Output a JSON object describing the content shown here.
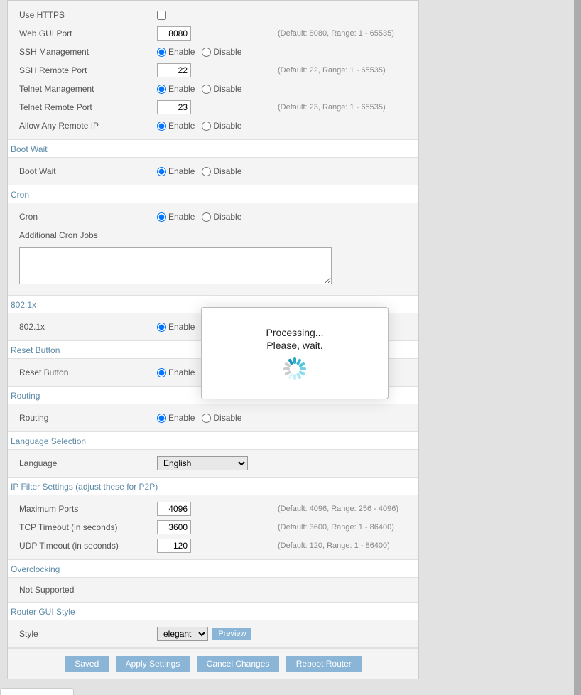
{
  "radio": {
    "enable": "Enable",
    "disable": "Disable"
  },
  "remote": {
    "useHttps": {
      "label": "Use HTTPS"
    },
    "webGuiPort": {
      "label": "Web GUI Port",
      "value": "8080",
      "hint": "(Default: 8080, Range: 1 - 65535)"
    },
    "sshMgmt": {
      "label": "SSH Management"
    },
    "sshPort": {
      "label": "SSH Remote Port",
      "value": "22",
      "hint": "(Default: 22, Range: 1 - 65535)"
    },
    "telnetMgmt": {
      "label": "Telnet Management"
    },
    "telnetPort": {
      "label": "Telnet Remote Port",
      "value": "23",
      "hint": "(Default: 23, Range: 1 - 65535)"
    },
    "allowAny": {
      "label": "Allow Any Remote IP"
    }
  },
  "bootWait": {
    "header": "Boot Wait",
    "label": "Boot Wait"
  },
  "cron": {
    "header": "Cron",
    "label": "Cron",
    "jobsLabel": "Additional Cron Jobs",
    "jobs": ""
  },
  "dot1x": {
    "header": "802.1x",
    "label": "802.1x"
  },
  "resetBtn": {
    "header": "Reset Button",
    "label": "Reset Button"
  },
  "routing": {
    "header": "Routing",
    "label": "Routing"
  },
  "lang": {
    "header": "Language Selection",
    "label": "Language",
    "value": "English"
  },
  "ipfilter": {
    "header": "IP Filter Settings (adjust these for P2P)",
    "maxPorts": {
      "label": "Maximum Ports",
      "value": "4096",
      "hint": "(Default: 4096, Range: 256 - 4096)"
    },
    "tcp": {
      "label": "TCP Timeout (in seconds)",
      "value": "3600",
      "hint": "(Default: 3600, Range: 1 - 86400)"
    },
    "udp": {
      "label": "UDP Timeout (in seconds)",
      "value": "120",
      "hint": "(Default: 120, Range: 1 - 86400)"
    }
  },
  "overclock": {
    "header": "Overclocking",
    "text": "Not Supported"
  },
  "style": {
    "header": "Router GUI Style",
    "label": "Style",
    "value": "elegant",
    "preview": "Preview"
  },
  "buttons": {
    "saved": "Saved",
    "apply": "Apply Settings",
    "cancel": "Cancel Changes",
    "reboot": "Reboot Router"
  },
  "modal": {
    "line1": "Processing...",
    "line2": "Please, wait."
  },
  "spinnerColors": [
    "#2aa7c7",
    "#3cb8d4",
    "#55c5dd",
    "#72d1e4",
    "#8edceb",
    "#a9e6f1",
    "#c4eff6",
    "#dff8fb",
    "#ccc",
    "#ccc",
    "#ccc",
    "#1d95b8"
  ]
}
